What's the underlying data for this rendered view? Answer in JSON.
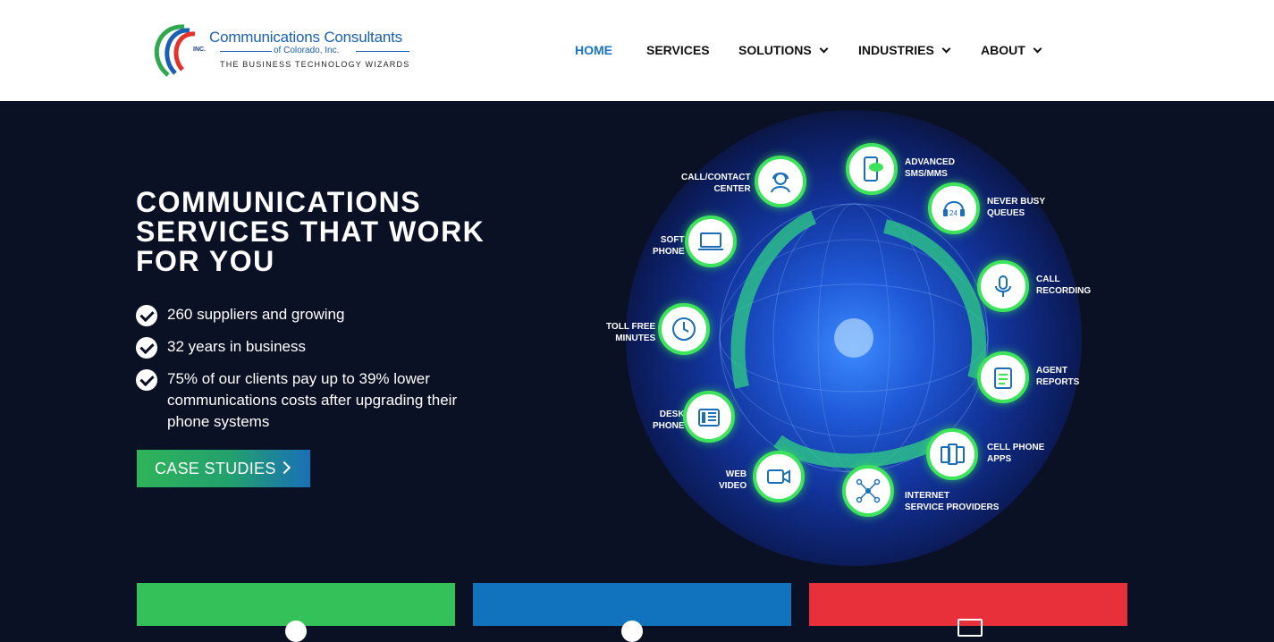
{
  "header": {
    "logo": {
      "inc": "INC.",
      "name": "Communications Consultants",
      "sub": "of Colorado, Inc.",
      "tagline": "THE BUSINESS TECHNOLOGY WIZARDS"
    },
    "nav": [
      {
        "label": "HOME",
        "active": true,
        "dropdown": false
      },
      {
        "label": "SERVICES",
        "active": false,
        "dropdown": false
      },
      {
        "label": "SOLUTIONS",
        "active": false,
        "dropdown": true
      },
      {
        "label": "INDUSTRIES",
        "active": false,
        "dropdown": true
      },
      {
        "label": "ABOUT",
        "active": false,
        "dropdown": true
      }
    ]
  },
  "hero": {
    "title": "COMMUNICATIONS SERVICES THAT WORK FOR YOU",
    "bullets": [
      "260 suppliers and growing",
      "32 years in business",
      "75% of our clients pay up to 39% lower communications costs after upgrading their phone systems"
    ],
    "cta_label": "CASE STUDIES"
  },
  "features": [
    {
      "label1": "CALL/CONTACT",
      "label2": "CENTER",
      "icon": "headset-agent-icon"
    },
    {
      "label1": "ADVANCED",
      "label2": "SMS/MMS",
      "icon": "mobile-chat-icon"
    },
    {
      "label1": "NEVER BUSY",
      "label2": "QUEUES",
      "icon": "headset-24-icon"
    },
    {
      "label1": "SOFT",
      "label2": "PHONE",
      "icon": "laptop-phone-icon"
    },
    {
      "label1": "CALL",
      "label2": "RECORDING",
      "icon": "microphone-icon"
    },
    {
      "label1": "TOLL FREE",
      "label2": "MINUTES",
      "icon": "clock-icon"
    },
    {
      "label1": "AGENT",
      "label2": "REPORTS",
      "icon": "clipboard-icon"
    },
    {
      "label1": "DESK",
      "label2": "PHONE",
      "icon": "desk-phone-icon"
    },
    {
      "label1": "CELL PHONE",
      "label2": "APPS",
      "icon": "cell-phones-icon"
    },
    {
      "label1": "WEB",
      "label2": "VIDEO",
      "icon": "video-camera-icon"
    },
    {
      "label1": "INTERNET",
      "label2": "SERVICE PROVIDERS",
      "icon": "network-icon"
    }
  ],
  "colors": {
    "accent_blue": "#1a73c8",
    "feature_ring": "#3ee35c",
    "card_green": "#34c15a",
    "card_blue": "#1173be",
    "card_red": "#e8303a"
  }
}
